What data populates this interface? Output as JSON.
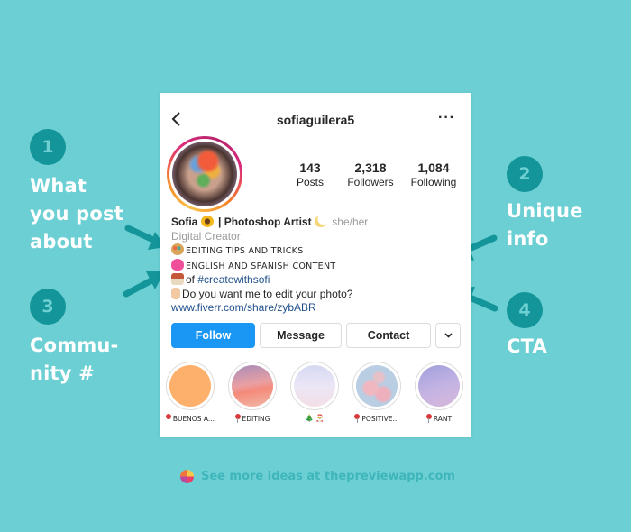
{
  "annotations": [
    {
      "number": "1",
      "lines": [
        "What",
        "you post",
        "about"
      ]
    },
    {
      "number": "2",
      "lines": [
        "Unique",
        "info"
      ]
    },
    {
      "number": "3",
      "lines": [
        "Commu-",
        "nity #"
      ]
    },
    {
      "number": "4",
      "lines": [
        "CTA"
      ]
    }
  ],
  "colors": {
    "background": "#6ccfd3",
    "badge": "#13959a",
    "arrow": "#13959a",
    "follow_button": "#1a97f5"
  },
  "profile": {
    "back_icon": "chevron-left-icon",
    "username": "sofiaguilera5",
    "more_icon": "more-horizontal-icon",
    "more_label": "···",
    "stats": [
      {
        "value": "143",
        "label": "Posts"
      },
      {
        "value": "2,318",
        "label": "Followers"
      },
      {
        "value": "1,084",
        "label": "Following"
      }
    ],
    "bio": {
      "name_part1": "Sofia",
      "name_emoji": "sunflower",
      "name_part2": " | Photoshop Artist",
      "name_emoji2": "crescent-moon",
      "pronouns": "she/her",
      "category": "Digital Creator",
      "line1_emoji": "artist-palette",
      "line1": "EDITING TIPS AND TRICKS",
      "line2_emoji": "growing-heart",
      "line2": "ENGLISH AND SPANISH CONTENT",
      "line3_emoji": "house",
      "line3_prefix": "of ",
      "line3_hashtag": "#createwithsofi",
      "line4_emoji": "pointing-down-hand",
      "line4": "Do you want me to edit your photo?",
      "link": "www.fiverr.com/share/zybABR"
    },
    "buttons": {
      "follow": "Follow",
      "message": "Message",
      "contact": "Contact",
      "dropdown_icon": "chevron-down-icon",
      "dropdown_label": "⌄"
    },
    "highlights": [
      {
        "label": "BUENOS A...",
        "icon": "pin-icon"
      },
      {
        "label": "EDITING",
        "icon": "pin-icon"
      },
      {
        "label": "🎄 🎅",
        "icon": "tree-santa-icons"
      },
      {
        "label": "POSITIVE...",
        "icon": "pin-icon"
      },
      {
        "label": "RANT",
        "icon": "pin-icon"
      }
    ]
  },
  "footer": {
    "icon": "thepreviewapp-logo-icon",
    "text": "See more ideas at thepreviewapp.com"
  }
}
